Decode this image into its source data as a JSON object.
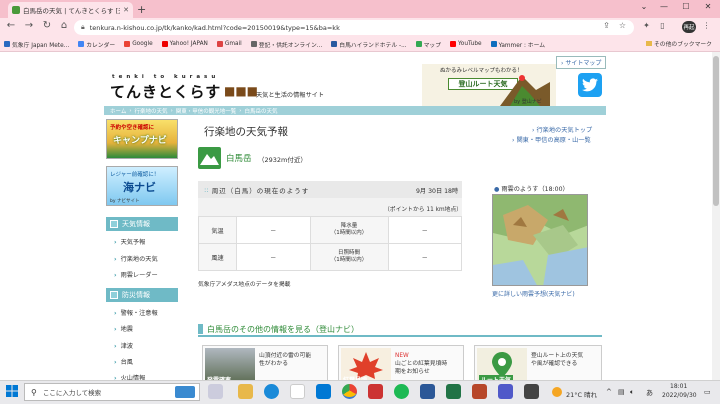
{
  "browser": {
    "tab_title": "白馬岳の天気 | てんきとくらす [天気...",
    "url": "tenkura.n-kishou.co.jp/tk/kanko/kad.html?code=20150019&type=15&ba=kk",
    "profile_label": "再起",
    "bookmarks": [
      "気象庁 Japan Mete...",
      "カレンダー",
      "Google",
      "Yahoo! JAPAN",
      "Gmail",
      "登記・供託オンライン...",
      "白馬ハイランドホテル -...",
      "マップ",
      "YouTube",
      "Yammer : ホーム"
    ],
    "bookmarks_other": "その他のブックマーク"
  },
  "site": {
    "logo_small": "tenki to kurasu",
    "logo": "てんきとくらす",
    "tagline": "天気と生活の情報サイト",
    "sitemap": "サイトマップ",
    "tozan_caption": "ぬかるみレベルマップもわかる！",
    "tozan_sign": "登山ルート天気",
    "tozan_sub": "by 登山ナビ",
    "breadcrumb": [
      "ホーム",
      "行楽地の天気",
      "関東・甲信の観光地一覧",
      "白馬岳の天気"
    ]
  },
  "sidebar": {
    "camp_banner_top": "予約や空き確認に",
    "camp_banner_main": "キャンプナビ",
    "umi_banner_top": "レジャー前確認に！",
    "umi_banner_main": "海ナビ",
    "umi_banner_sub": "by ナビサイト",
    "section1": "天気情報",
    "section1_items": [
      "天気予報",
      "行楽地の天気",
      "雨雲レーダー"
    ],
    "section2": "防災情報",
    "section2_items": [
      "警報・注意報",
      "地震",
      "津波",
      "台風",
      "火山情報"
    ]
  },
  "main": {
    "title": "行楽地の天気予報",
    "link_top": "行楽地の天気トップ",
    "link_list": "関東・甲信の高原・山一覧",
    "mountain_name": "白馬岳",
    "mountain_elev": "（2932m付近）",
    "surroundings_title": "周辺（白馬）の現在のようす",
    "surroundings_date": "9月 30日 18時",
    "surroundings_point": "（ポイントから 11 km地点）",
    "obs_rows": [
      {
        "label": "気温",
        "value": "－",
        "label2a": "降水量",
        "label2b": "（1時間以内）",
        "value2": "－"
      },
      {
        "label": "風速",
        "value": "－",
        "label2a": "日照時間",
        "label2b": "（1時間以内）",
        "value2": "－"
      }
    ],
    "amedas_note": "気象庁アメダス地点のデータを掲載",
    "radar_title": "雨雲のようす（18:00）",
    "radar_link": "更に詳しい雨雲予想(天気ナビ)",
    "other_head": "白馬岳のその他の情報を見る（登山ナビ）",
    "cards": [
      {
        "label": "発雷確率",
        "text1": "山頂付近の雷の可能",
        "text2": "性がわかる"
      },
      {
        "label": "紅葉見頃",
        "new": "NEW",
        "text1": "山ごとの紅葉見頃時",
        "text2": "期をお知らせ"
      },
      {
        "label": "ルート天気",
        "text1": "登山ルート上の天気",
        "text2": "や風が確認できる"
      }
    ]
  },
  "taskbar": {
    "search_placeholder": "ここに入力して検索",
    "weather": "21°C 晴れ",
    "ime": "あ",
    "time": "18:01",
    "date": "2022/09/30"
  }
}
